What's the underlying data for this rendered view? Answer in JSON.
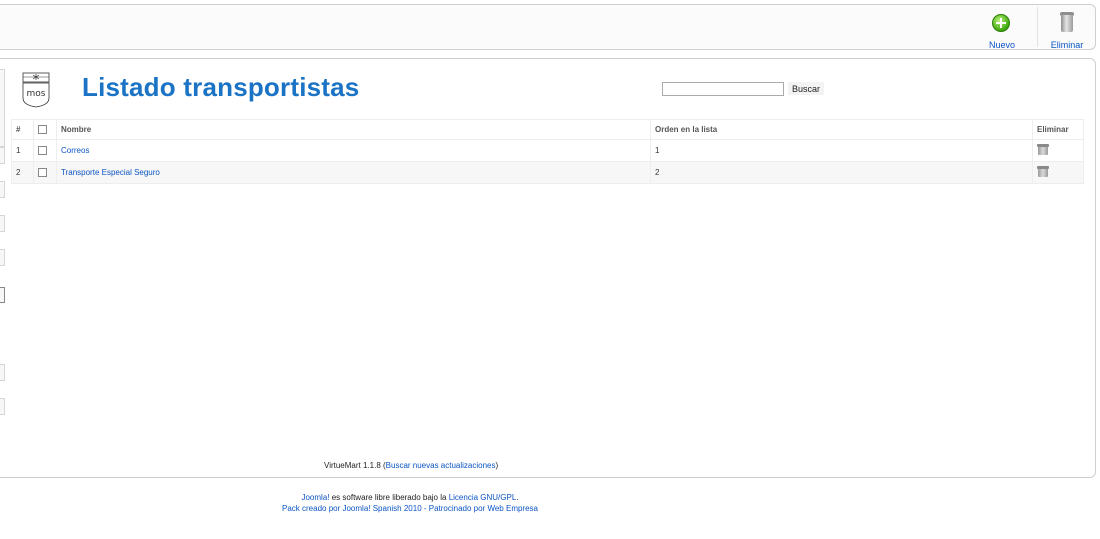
{
  "toolbar": {
    "new_label": "Nuevo",
    "delete_label": "Eliminar"
  },
  "header": {
    "logo_text": "mos",
    "title": "Listado transportistas",
    "search": {
      "value": "",
      "button_label": "Buscar"
    }
  },
  "table": {
    "columns": {
      "num": "#",
      "name": "Nombre",
      "order": "Orden en la lista",
      "delete": "Eliminar"
    },
    "rows": [
      {
        "num": "1",
        "name": "Correos",
        "order": "1"
      },
      {
        "num": "2",
        "name": "Transporte Especial Seguro",
        "order": "2"
      }
    ]
  },
  "footer": {
    "version_prefix": "VirtueMart 1.1.8 (",
    "update_link": "Buscar nuevas actualizaciones",
    "version_suffix": ")",
    "line1_link1": "Joomla!",
    "line1_text": " es software libre liberado bajo la ",
    "line1_link2": "Licencia GNU/GPL",
    "line1_end": ".",
    "line2": "Pack creado por Joomla! Spanish 2010 - Patrocinado por Web Empresa"
  },
  "colors": {
    "title_blue": "#1a73c4",
    "link_blue": "#0b55c4",
    "new_green": "#3ea90e"
  }
}
